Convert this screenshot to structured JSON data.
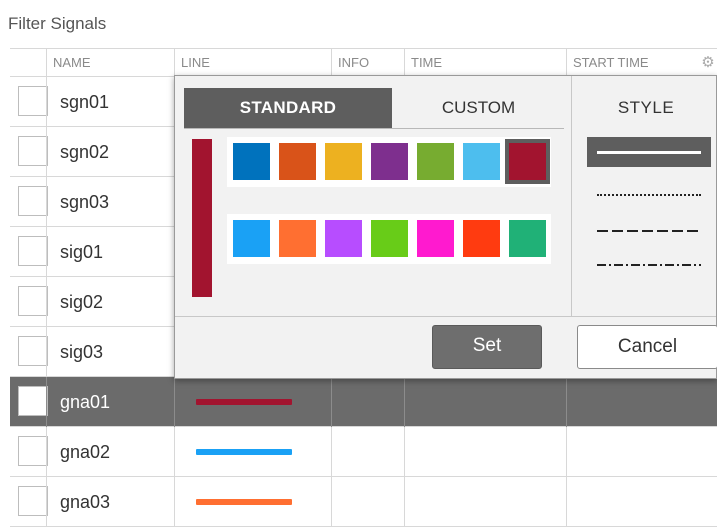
{
  "title": "Filter Signals",
  "columns": [
    "NAME",
    "LINE",
    "INFO",
    "TIME",
    "START TIME"
  ],
  "gear_icon": "gear-icon",
  "rows": [
    {
      "name": "sgn01",
      "line_color": null,
      "selected": false
    },
    {
      "name": "sgn02",
      "line_color": null,
      "selected": false
    },
    {
      "name": "sgn03",
      "line_color": null,
      "selected": false
    },
    {
      "name": "sig01",
      "line_color": null,
      "selected": false
    },
    {
      "name": "sig02",
      "line_color": null,
      "selected": false
    },
    {
      "name": "sig03",
      "line_color": null,
      "selected": false
    },
    {
      "name": "gna01",
      "line_color": "#A2142F",
      "selected": true
    },
    {
      "name": "gna02",
      "line_color": "#1AA1F5",
      "selected": false
    },
    {
      "name": "gna03",
      "line_color": "#FF6F31",
      "selected": false
    }
  ],
  "popup": {
    "tab_standard": "STANDARD",
    "tab_custom": "CUSTOM",
    "style_label": "STYLE",
    "preview_color": "#A2142F",
    "standard_colors": [
      "#0072BD",
      "#D95319",
      "#EDB120",
      "#7E2F8E",
      "#77AC30",
      "#4DBEEE",
      "#A2142F"
    ],
    "bright_colors": [
      "#1AA1F5",
      "#FF6F31",
      "#B74DFF",
      "#68CC18",
      "#FF1ACF",
      "#FF3B10",
      "#20B177"
    ],
    "selected_color_index": 6,
    "line_styles": [
      "solid",
      "dotted",
      "dashed",
      "dash-dot"
    ],
    "selected_style_index": 0,
    "set_label": "Set",
    "cancel_label": "Cancel"
  }
}
